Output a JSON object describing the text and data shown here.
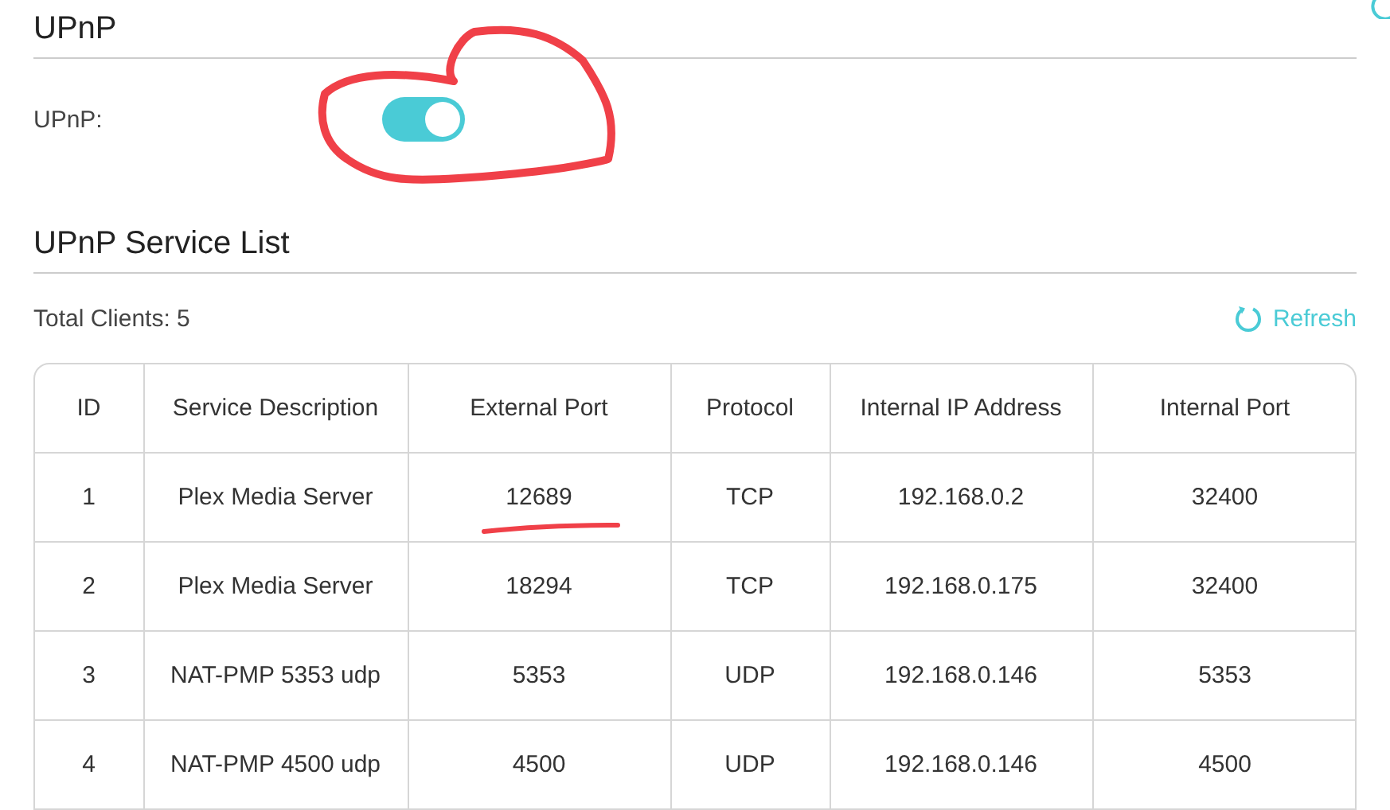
{
  "upnp_section": {
    "title": "UPnP",
    "label": "UPnP:",
    "toggle_on": true
  },
  "service_list": {
    "title": "UPnP Service List",
    "total_clients": "Total Clients: 5",
    "refresh": "Refresh",
    "columns": [
      "ID",
      "Service Description",
      "External Port",
      "Protocol",
      "Internal IP Address",
      "Internal Port"
    ],
    "rows": [
      [
        "1",
        "Plex Media Server",
        "12689",
        "TCP",
        "192.168.0.2",
        "32400"
      ],
      [
        "2",
        "Plex Media Server",
        "18294",
        "TCP",
        "192.168.0.175",
        "32400"
      ],
      [
        "3",
        "NAT-PMP 5353 udp",
        "5353",
        "UDP",
        "192.168.0.146",
        "5353"
      ],
      [
        "4",
        "NAT-PMP 4500 udp",
        "4500",
        "UDP",
        "192.168.0.146",
        "4500"
      ]
    ]
  }
}
